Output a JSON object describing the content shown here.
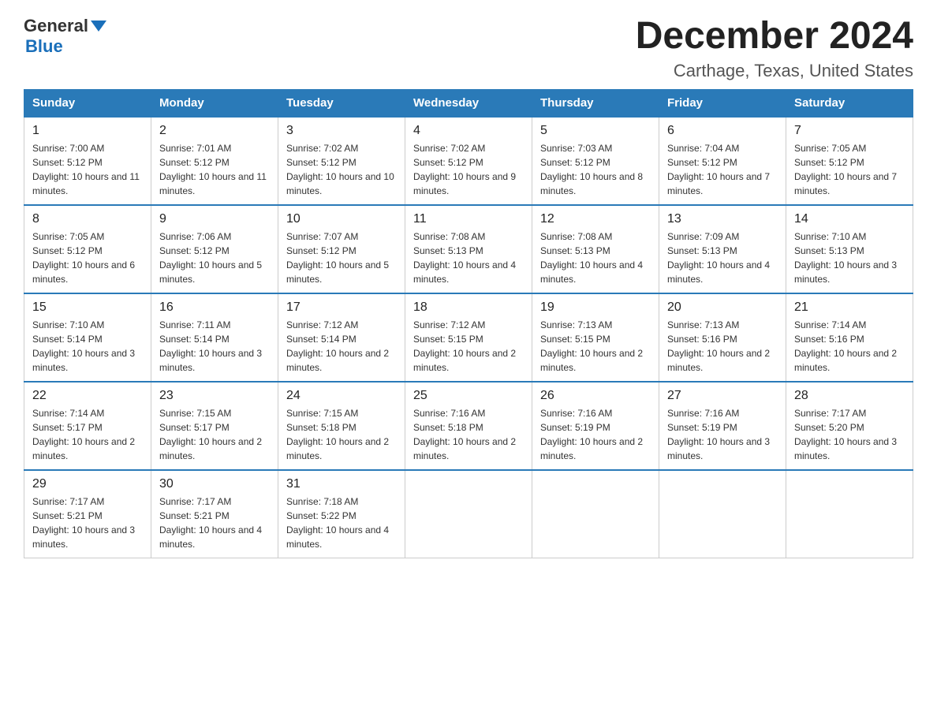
{
  "header": {
    "logo_general": "General",
    "logo_blue": "Blue",
    "month_title": "December 2024",
    "location": "Carthage, Texas, United States"
  },
  "days_of_week": [
    "Sunday",
    "Monday",
    "Tuesday",
    "Wednesday",
    "Thursday",
    "Friday",
    "Saturday"
  ],
  "weeks": [
    [
      {
        "day": "1",
        "sunrise": "7:00 AM",
        "sunset": "5:12 PM",
        "daylight": "10 hours and 11 minutes."
      },
      {
        "day": "2",
        "sunrise": "7:01 AM",
        "sunset": "5:12 PM",
        "daylight": "10 hours and 11 minutes."
      },
      {
        "day": "3",
        "sunrise": "7:02 AM",
        "sunset": "5:12 PM",
        "daylight": "10 hours and 10 minutes."
      },
      {
        "day": "4",
        "sunrise": "7:02 AM",
        "sunset": "5:12 PM",
        "daylight": "10 hours and 9 minutes."
      },
      {
        "day": "5",
        "sunrise": "7:03 AM",
        "sunset": "5:12 PM",
        "daylight": "10 hours and 8 minutes."
      },
      {
        "day": "6",
        "sunrise": "7:04 AM",
        "sunset": "5:12 PM",
        "daylight": "10 hours and 7 minutes."
      },
      {
        "day": "7",
        "sunrise": "7:05 AM",
        "sunset": "5:12 PM",
        "daylight": "10 hours and 7 minutes."
      }
    ],
    [
      {
        "day": "8",
        "sunrise": "7:05 AM",
        "sunset": "5:12 PM",
        "daylight": "10 hours and 6 minutes."
      },
      {
        "day": "9",
        "sunrise": "7:06 AM",
        "sunset": "5:12 PM",
        "daylight": "10 hours and 5 minutes."
      },
      {
        "day": "10",
        "sunrise": "7:07 AM",
        "sunset": "5:12 PM",
        "daylight": "10 hours and 5 minutes."
      },
      {
        "day": "11",
        "sunrise": "7:08 AM",
        "sunset": "5:13 PM",
        "daylight": "10 hours and 4 minutes."
      },
      {
        "day": "12",
        "sunrise": "7:08 AM",
        "sunset": "5:13 PM",
        "daylight": "10 hours and 4 minutes."
      },
      {
        "day": "13",
        "sunrise": "7:09 AM",
        "sunset": "5:13 PM",
        "daylight": "10 hours and 4 minutes."
      },
      {
        "day": "14",
        "sunrise": "7:10 AM",
        "sunset": "5:13 PM",
        "daylight": "10 hours and 3 minutes."
      }
    ],
    [
      {
        "day": "15",
        "sunrise": "7:10 AM",
        "sunset": "5:14 PM",
        "daylight": "10 hours and 3 minutes."
      },
      {
        "day": "16",
        "sunrise": "7:11 AM",
        "sunset": "5:14 PM",
        "daylight": "10 hours and 3 minutes."
      },
      {
        "day": "17",
        "sunrise": "7:12 AM",
        "sunset": "5:14 PM",
        "daylight": "10 hours and 2 minutes."
      },
      {
        "day": "18",
        "sunrise": "7:12 AM",
        "sunset": "5:15 PM",
        "daylight": "10 hours and 2 minutes."
      },
      {
        "day": "19",
        "sunrise": "7:13 AM",
        "sunset": "5:15 PM",
        "daylight": "10 hours and 2 minutes."
      },
      {
        "day": "20",
        "sunrise": "7:13 AM",
        "sunset": "5:16 PM",
        "daylight": "10 hours and 2 minutes."
      },
      {
        "day": "21",
        "sunrise": "7:14 AM",
        "sunset": "5:16 PM",
        "daylight": "10 hours and 2 minutes."
      }
    ],
    [
      {
        "day": "22",
        "sunrise": "7:14 AM",
        "sunset": "5:17 PM",
        "daylight": "10 hours and 2 minutes."
      },
      {
        "day": "23",
        "sunrise": "7:15 AM",
        "sunset": "5:17 PM",
        "daylight": "10 hours and 2 minutes."
      },
      {
        "day": "24",
        "sunrise": "7:15 AM",
        "sunset": "5:18 PM",
        "daylight": "10 hours and 2 minutes."
      },
      {
        "day": "25",
        "sunrise": "7:16 AM",
        "sunset": "5:18 PM",
        "daylight": "10 hours and 2 minutes."
      },
      {
        "day": "26",
        "sunrise": "7:16 AM",
        "sunset": "5:19 PM",
        "daylight": "10 hours and 2 minutes."
      },
      {
        "day": "27",
        "sunrise": "7:16 AM",
        "sunset": "5:19 PM",
        "daylight": "10 hours and 3 minutes."
      },
      {
        "day": "28",
        "sunrise": "7:17 AM",
        "sunset": "5:20 PM",
        "daylight": "10 hours and 3 minutes."
      }
    ],
    [
      {
        "day": "29",
        "sunrise": "7:17 AM",
        "sunset": "5:21 PM",
        "daylight": "10 hours and 3 minutes."
      },
      {
        "day": "30",
        "sunrise": "7:17 AM",
        "sunset": "5:21 PM",
        "daylight": "10 hours and 4 minutes."
      },
      {
        "day": "31",
        "sunrise": "7:18 AM",
        "sunset": "5:22 PM",
        "daylight": "10 hours and 4 minutes."
      },
      null,
      null,
      null,
      null
    ]
  ]
}
